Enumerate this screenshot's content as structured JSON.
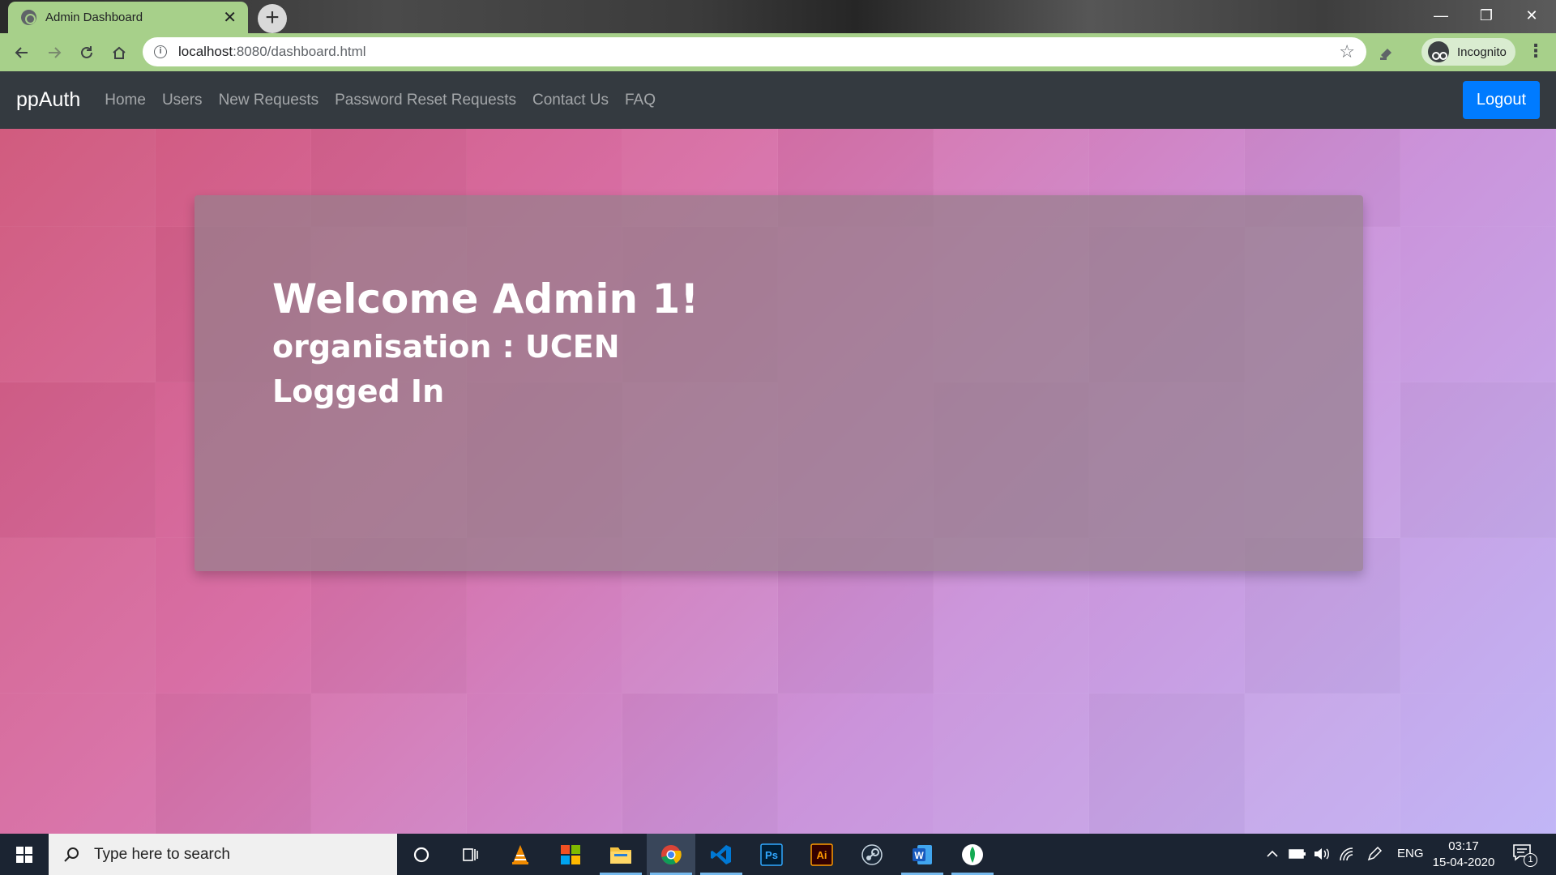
{
  "browser": {
    "tab_title": "Admin Dashboard",
    "tab_close": "✕",
    "new_tab": "+",
    "window_controls": {
      "minimize": "—",
      "restore": "❐",
      "close": "✕"
    },
    "url_host": "localhost",
    "url_rest": ":8080/dashboard.html",
    "profile_label": "Incognito",
    "menu": "⋮",
    "info_glyph": "i",
    "star_glyph": "☆",
    "theme_color": "#a7d08a"
  },
  "navbar": {
    "brand": "ppAuth",
    "links": [
      "Home",
      "Users",
      "New Requests",
      "Password Reset Requests",
      "Contact Us",
      "FAQ"
    ],
    "logout_label": "Logout",
    "bg_color": "#343a40",
    "button_color": "#007bff"
  },
  "dashboard": {
    "welcome": "Welcome Admin 1!",
    "organisation": "organisation : UCEN",
    "status": "Logged In"
  },
  "taskbar": {
    "search_placeholder": "Type here to search",
    "language": "ENG",
    "time": "03:17",
    "date": "15-04-2020",
    "notification_count": "1",
    "apps": [
      "cortana-icon",
      "task-view-icon",
      "vlc-icon",
      "microsoft-store-icon",
      "file-explorer-icon",
      "chrome-icon",
      "vscode-icon",
      "photoshop-icon",
      "illustrator-icon",
      "steam-icon",
      "word-icon",
      "mongodb-icon"
    ],
    "ps_label": "Ps",
    "ai_label": "Ai",
    "word_label": "W"
  }
}
